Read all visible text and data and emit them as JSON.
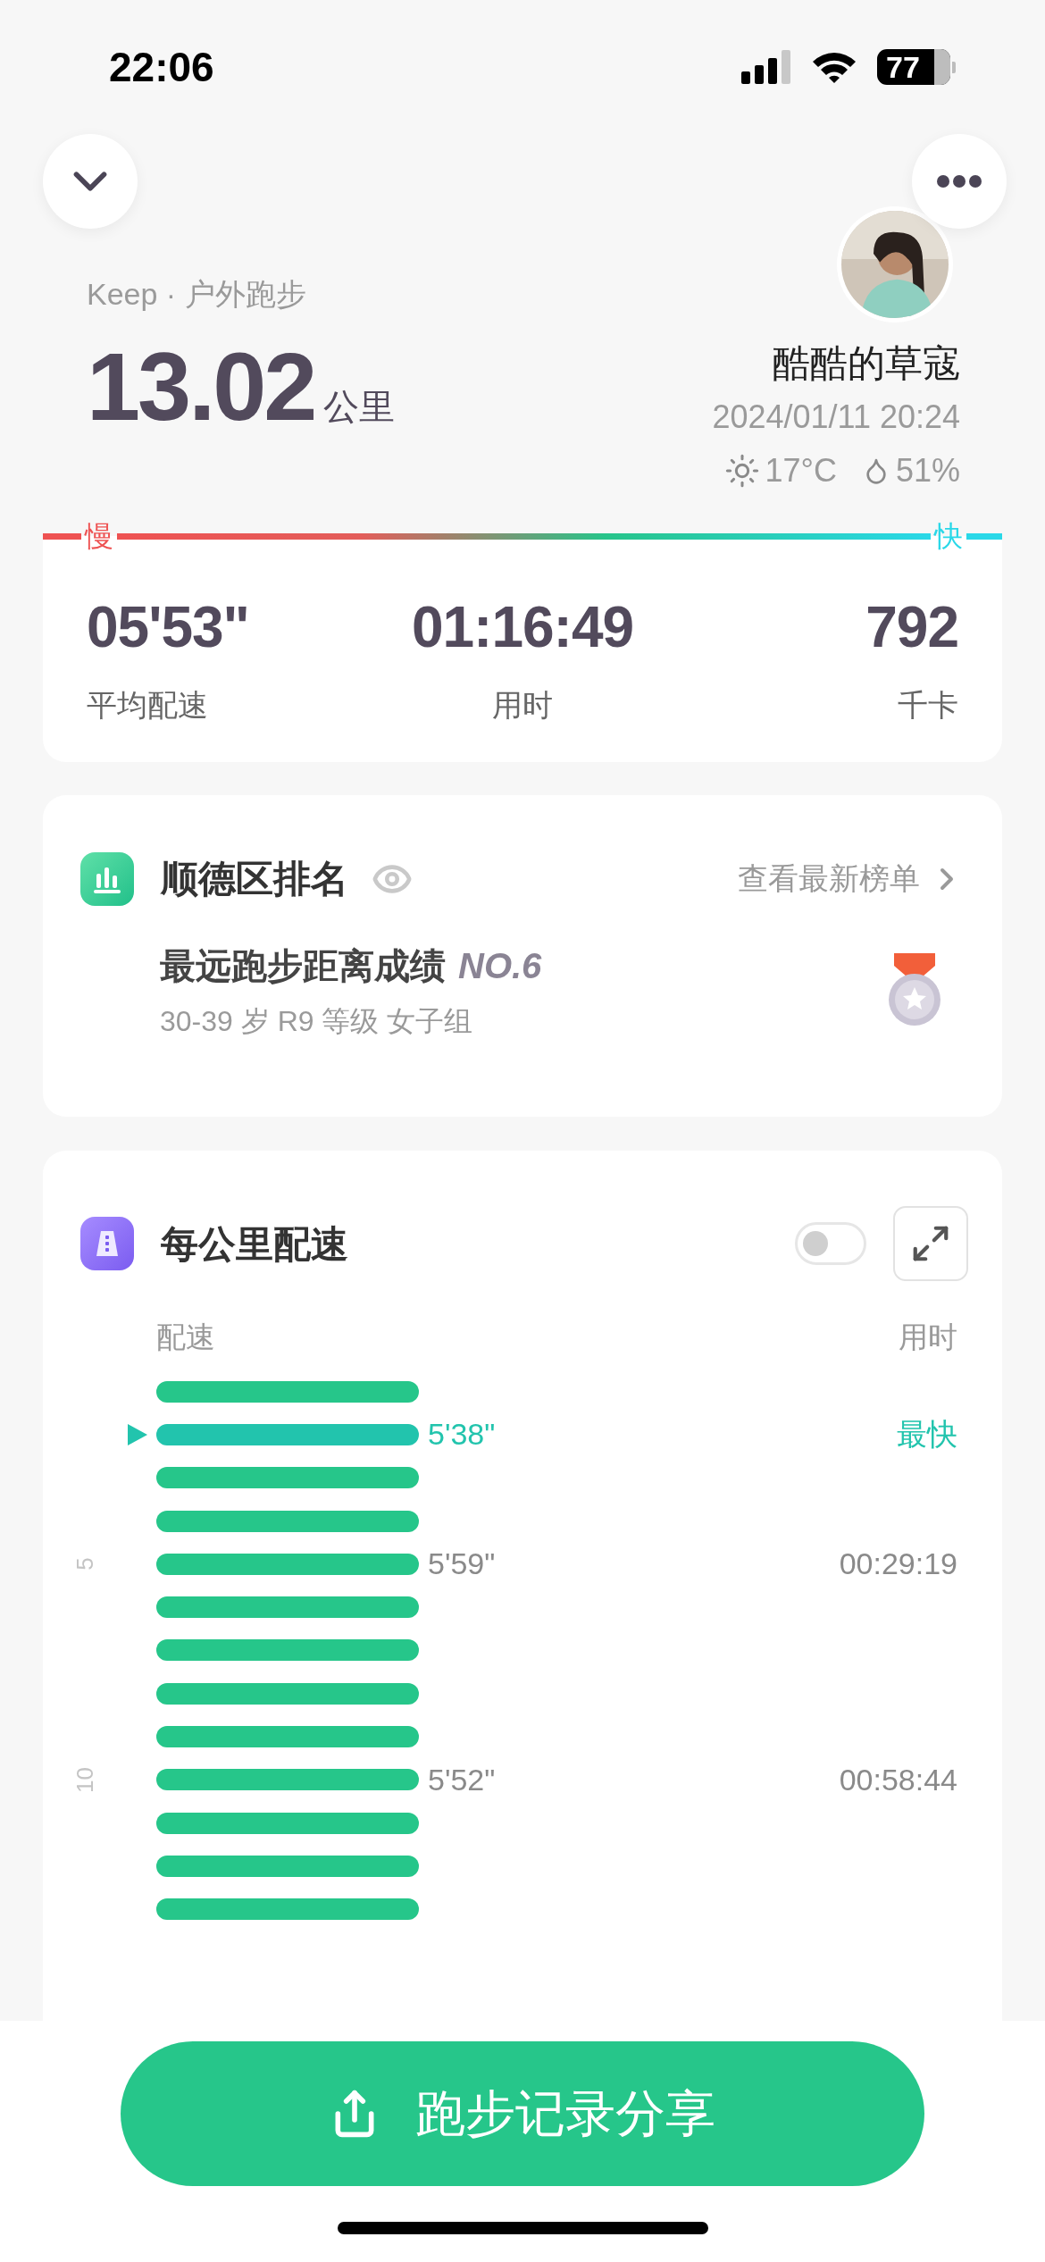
{
  "status_bar": {
    "time": "22:06",
    "battery": "77"
  },
  "activity": {
    "source": "Keep · 户外跑步",
    "distance": "13.02",
    "distance_unit": "公里",
    "user_name": "酷酷的草寇",
    "datetime": "2024/01/11 20:24",
    "temperature": "17°C",
    "humidity": "51%"
  },
  "pace_scale": {
    "slow_label": "慢",
    "fast_label": "快"
  },
  "stats": [
    {
      "value": "05'53\"",
      "label": "平均配速"
    },
    {
      "value": "01:16:49",
      "label": "用时"
    },
    {
      "value": "792",
      "label": "千卡"
    }
  ],
  "ranking": {
    "title": "顺德区排名",
    "link": "查看最新榜单",
    "achievement": "最远跑步距离成绩",
    "rank": "NO.6",
    "group": "30-39 岁 R9 等级 女子组"
  },
  "pace": {
    "title": "每公里配速",
    "toggle_on": false,
    "pace_header": "配速",
    "time_header": "用时",
    "rows": [
      {
        "highlighted": false
      },
      {
        "highlighted": true,
        "pace": "5'38\"",
        "time": "最快"
      },
      {
        "highlighted": false
      },
      {
        "highlighted": false
      },
      {
        "highlighted": false,
        "axis_label": "5",
        "pace": "5'59\"",
        "time": "00:29:19"
      },
      {
        "highlighted": false
      },
      {
        "highlighted": false
      },
      {
        "highlighted": false
      },
      {
        "highlighted": false
      },
      {
        "highlighted": false,
        "axis_label": "10",
        "pace": "5'52\"",
        "time": "00:58:44"
      },
      {
        "highlighted": false
      },
      {
        "highlighted": false
      },
      {
        "highlighted": false
      }
    ]
  },
  "share_button": "跑步记录分享"
}
